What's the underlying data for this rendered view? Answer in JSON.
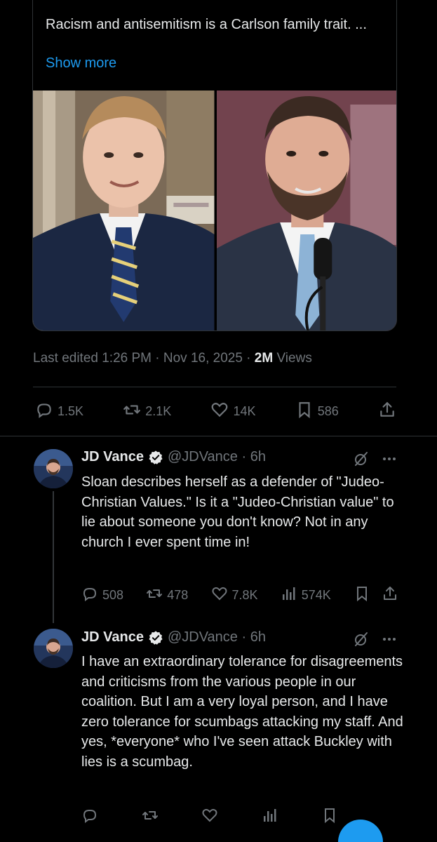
{
  "quote": {
    "text": "Racism and antisemitism is a Carlson family trait. ...",
    "show_more": "Show more"
  },
  "meta": {
    "edited": "Last edited 1:26 PM · Nov 16, 2025 · ",
    "views_count": "2M",
    "views_label": " Views"
  },
  "actions": {
    "replies": "1.5K",
    "reposts": "2.1K",
    "likes": "14K",
    "bookmarks": "586"
  },
  "replies": [
    {
      "name": "JD Vance",
      "handle": "@JDVance · 6h",
      "body": "Sloan describes herself as a defender of \"Judeo-Christian Values.\" Is it a \"Judeo-Christian value\" to lie about someone you don't know? Not in any church I ever spent time in!",
      "replies": "508",
      "reposts": "478",
      "likes": "7.8K",
      "views": "574K"
    },
    {
      "name": "JD Vance",
      "handle": "@JDVance · 6h",
      "body": "I have an extraordinary tolerance for disagreements and criticisms from the various people in our coalition. But I am a very loyal person, and I have zero tolerance for scumbags attacking my staff. And yes, *everyone* who I've seen attack Buckley with lies is a scumbag.",
      "replies": "",
      "reposts": "",
      "likes": "",
      "views": ""
    }
  ],
  "colors": {
    "accent": "#1d9bf0",
    "muted": "#71767b",
    "text": "#e7e9ea",
    "border": "#2f3336",
    "background": "#000000"
  }
}
